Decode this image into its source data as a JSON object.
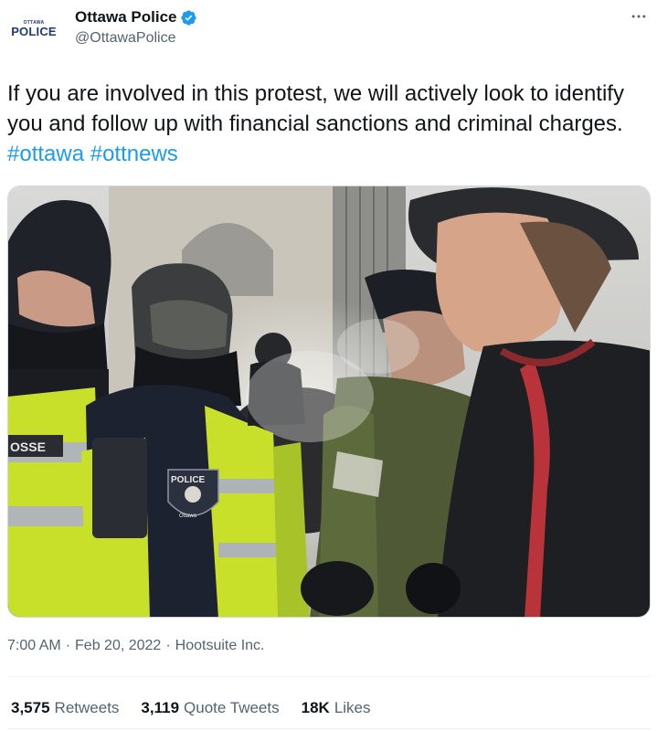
{
  "author": {
    "display_name": "Ottawa Police",
    "handle": "@OttawaPolice",
    "avatar_text_small": "OTTAWA",
    "avatar_text_big": "POLICE",
    "verified": true
  },
  "tweet": {
    "text": "If you are involved in this protest, we will actively look to identify you and follow up with financial sanctions and criminal charges.",
    "hashtags": [
      "#ottawa",
      "#ottnews"
    ],
    "media_alt": "photo",
    "photo_text": {
      "vest_left": "OSSE",
      "badge": "POLICE",
      "badge_bottom": "Ottawa"
    }
  },
  "meta": {
    "time": "7:00 AM",
    "date": "Feb 20, 2022",
    "source": "Hootsuite Inc.",
    "separator": "·"
  },
  "stats": {
    "retweets": {
      "count": "3,575",
      "label": "Retweets"
    },
    "quote_tweets": {
      "count": "3,119",
      "label": "Quote Tweets"
    },
    "likes": {
      "count": "18K",
      "label": "Likes"
    }
  },
  "colors": {
    "link": "#1d9bf0",
    "secondary_text": "#536471",
    "verified_badge": "#1d9bf0",
    "police_logo": "#1f3a73"
  },
  "icons": {
    "verified": "verified-badge-icon",
    "more": "more-options-icon"
  }
}
